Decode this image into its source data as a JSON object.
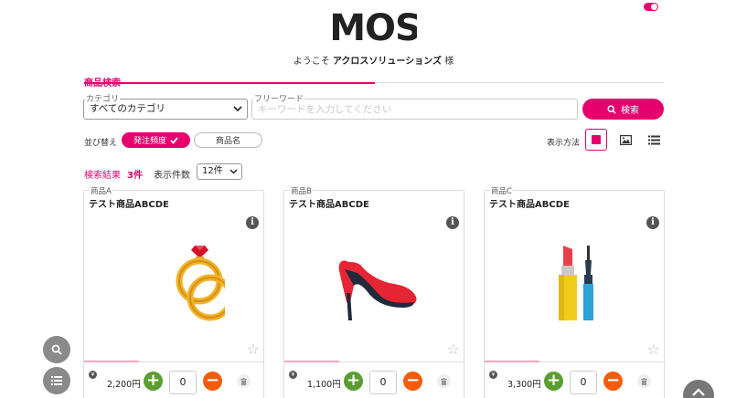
{
  "header": {
    "logo_text": "MOS",
    "welcome_prefix": "ようこそ",
    "company_name": "アクロスソリューションズ",
    "welcome_suffix": "様"
  },
  "search": {
    "section_title": "商品検索",
    "category_label": "カテゴリ",
    "category_value": "すべてのカテゴリ",
    "keyword_label": "フリーワード",
    "keyword_placeholder": "キーワードを入力してください",
    "keyword_value": "",
    "search_button_label": "検索"
  },
  "sort": {
    "label": "並び替え",
    "options": [
      "発注頻度",
      "商品名"
    ],
    "selected": "発注頻度"
  },
  "view": {
    "label": "表示方法",
    "modes": [
      "tile-icon",
      "image-icon",
      "list-icon"
    ],
    "selected": "tile-icon"
  },
  "results": {
    "label": "検索結果",
    "count": "3件",
    "per_page_label": "表示件数",
    "per_page_value": "12件"
  },
  "products": [
    {
      "code": "商品A",
      "name": "テスト商品ABCDE",
      "price": "2,200円",
      "quantity": "0",
      "image": "rings-icon"
    },
    {
      "code": "商品B",
      "name": "テスト商品ABCDE",
      "price": "1,100円",
      "quantity": "0",
      "image": "high-heel-icon"
    },
    {
      "code": "商品C",
      "name": "テスト商品ABCDE",
      "price": "3,300円",
      "quantity": "0",
      "image": "lipstick-mascara-icon"
    }
  ],
  "colors": {
    "accent": "#e6006e",
    "plus": "#5a9e2f",
    "minus": "#f25c0d"
  }
}
